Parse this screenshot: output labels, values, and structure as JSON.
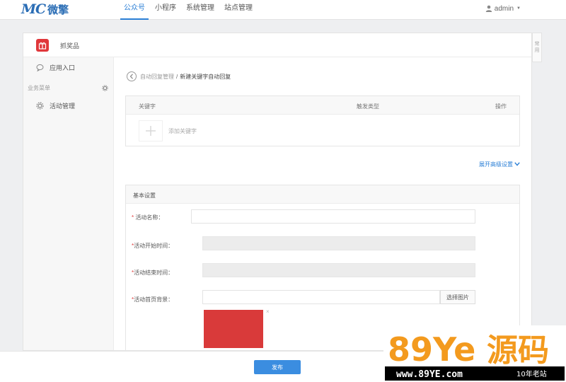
{
  "topbar": {
    "logo_mark": "MC",
    "logo_text": "微擎",
    "nav": [
      "公众号",
      "小程序",
      "系统管理",
      "站点管理"
    ],
    "active_nav": 0,
    "user": "admin"
  },
  "app": {
    "name": "抓奖品"
  },
  "sidebar": {
    "entry_label": "应用入口",
    "section_label": "业务菜单",
    "items": [
      {
        "label": "活动管理"
      }
    ]
  },
  "breadcrumb": {
    "parent": "自动回复管理",
    "separator": "/",
    "current": "新建关键字自动回复"
  },
  "keyword_table": {
    "columns": [
      "关键字",
      "触发类型",
      "操作"
    ],
    "add_label": "添加关键字"
  },
  "advanced_label": "展开高级设置",
  "basic": {
    "title": "基本设置",
    "fields": [
      {
        "label": "活动名称：",
        "value": ""
      },
      {
        "label": "活动开始时间：",
        "value": ""
      },
      {
        "label": "活动结束时间：",
        "value": ""
      },
      {
        "label": "活动首页背景：",
        "value": ""
      }
    ],
    "pick_image_label": "选择图片",
    "preview_color": "#d93a3a",
    "remove_mark": "×"
  },
  "side_tab": "常用",
  "footer": {
    "publish_label": "发布"
  },
  "watermark": {
    "brand_latin": "89Ye",
    "brand_cn": "源码",
    "url": "www.89YE.com",
    "slogan": "10年老站"
  },
  "colors": {
    "accent": "#2b7fd6",
    "brand": "#2a6db5",
    "app_icon": "#e0373b",
    "publish": "#3b8de0",
    "watermark_orange": "#f39a1e"
  }
}
